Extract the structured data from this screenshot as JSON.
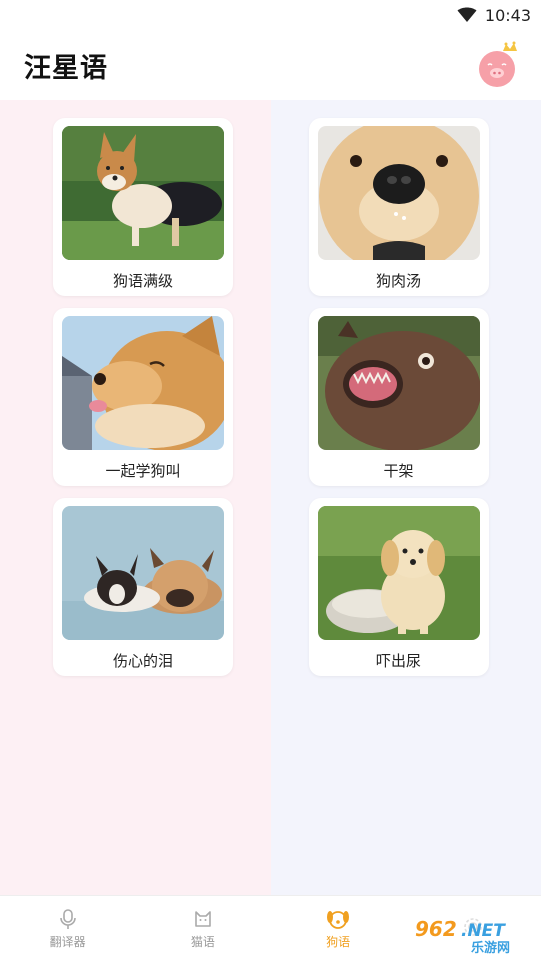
{
  "status_bar": {
    "time": "10:43",
    "icons": [
      "wifi-icon"
    ]
  },
  "header": {
    "title": "汪星语",
    "avatar_icon": "pig-with-crown-icon"
  },
  "cards": [
    {
      "label": "狗语满级",
      "image": "corgi-photo"
    },
    {
      "label": "狗肉汤",
      "image": "golden-puppy-closeup-photo"
    },
    {
      "label": "一起学狗叫",
      "image": "shiba-tongue-photo"
    },
    {
      "label": "干架",
      "image": "barking-pug-photo"
    },
    {
      "label": "伤心的泪",
      "image": "french-bulldogs-lying-photo"
    },
    {
      "label": "吓出尿",
      "image": "golden-puppy-bowl-photo"
    }
  ],
  "tabs": [
    {
      "label": "翻译器",
      "icon": "microphone-icon",
      "active": false
    },
    {
      "label": "猫语",
      "icon": "cat-icon",
      "active": false
    },
    {
      "label": "狗语",
      "icon": "dog-icon",
      "active": true
    },
    {
      "label": "",
      "icon": "settings-icon",
      "active": false
    }
  ],
  "watermark": {
    "text_top": "962.NET",
    "text_bottom": "乐游网"
  },
  "colors": {
    "accent": "#f0a020",
    "left_bg": "#fdf0f4",
    "right_bg": "#f3f4fc"
  }
}
